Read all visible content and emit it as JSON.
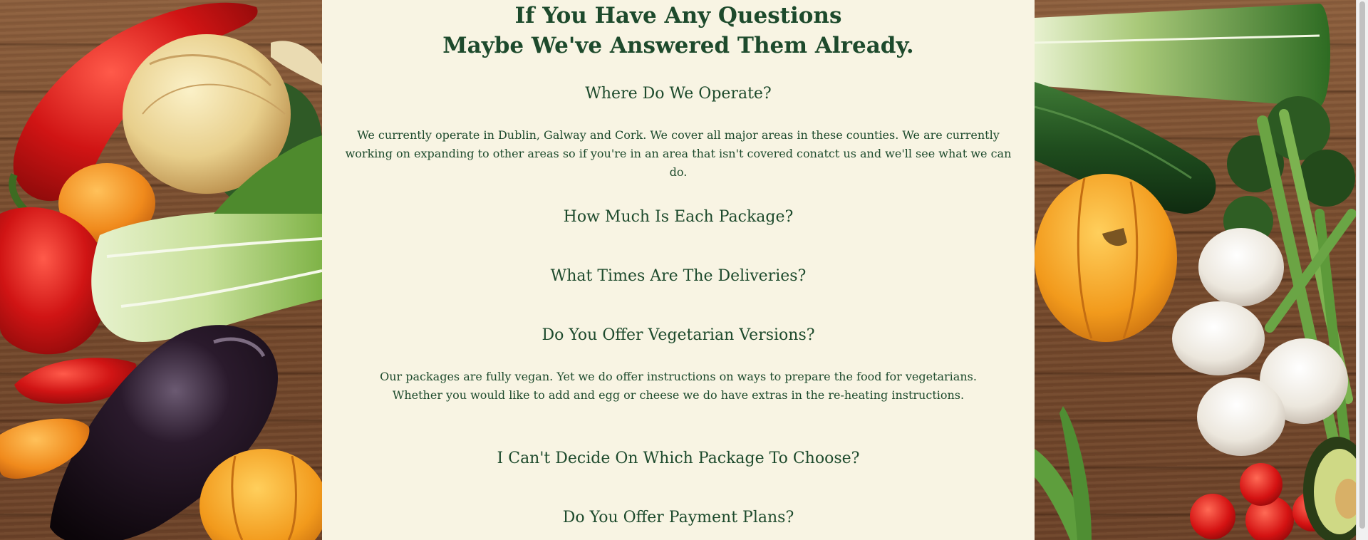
{
  "faq": {
    "heading_line1": "If You Have Any Questions",
    "heading_line2": "Maybe We've Answered Them Already.",
    "items": [
      {
        "question": "Where Do We Operate?",
        "answer": "We currently operate in Dublin, Galway and Cork. We cover all major areas in these counties. We are currently working on expanding to other areas so if you're in an area that isn't covered conatct us and we'll see what we can do."
      },
      {
        "question": "How Much Is Each Package?",
        "answer": ""
      },
      {
        "question": "What Times Are The Deliveries?",
        "answer": ""
      },
      {
        "question": "Do You Offer Vegetarian Versions?",
        "answer": "Our packages are fully vegan. Yet we do offer instructions on ways to prepare the food for vegetarians. Whether you would like to add and egg or cheese we do have extras in the re-heating instructions."
      },
      {
        "question": "I Can't Decide On Which Package To Choose?",
        "answer": ""
      },
      {
        "question": "Do You Offer Payment Plans?",
        "answer": ""
      }
    ]
  },
  "colors": {
    "panel_background": "#f8f4e3",
    "text_green": "#1d4a2c",
    "wood": "#74492c"
  },
  "decor": {
    "left_vegetables": [
      "red-pepper",
      "onion",
      "orange-pepper",
      "bok-choy",
      "red-chili",
      "eggplant",
      "orange-chili",
      "pumpkin"
    ],
    "right_vegetables": [
      "leek",
      "zucchini",
      "pumpkin",
      "broccoli",
      "asparagus",
      "garlic",
      "pea-pods",
      "cherry-tomatoes",
      "avocado"
    ]
  }
}
